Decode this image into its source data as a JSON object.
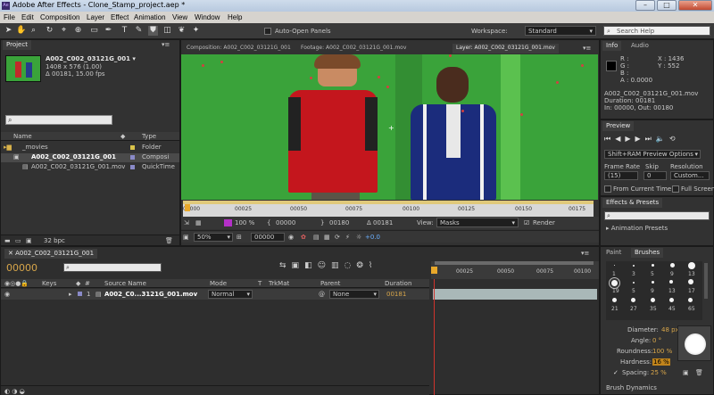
{
  "app": {
    "title": "Adobe After Effects - Clone_Stamp_project.aep *",
    "logo": "Ae"
  },
  "menu": [
    "File",
    "Edit",
    "Composition",
    "Layer",
    "Effect",
    "Animation",
    "View",
    "Window",
    "Help"
  ],
  "toolbar": {
    "auto_open_panels": "Auto-Open Panels",
    "workspace_label": "Workspace:",
    "workspace_value": "Standard",
    "search_help": "Search Help"
  },
  "project": {
    "tab": "Project",
    "item_name": "A002_C002_03121G_001 ▾",
    "item_size": "1408 x 576 (1.00)",
    "item_duration": "Δ 00181, 15.00 fps",
    "col_name": "Name",
    "col_type": "Type",
    "rows": [
      {
        "name": "_movies",
        "type": "Folder"
      },
      {
        "name": "A002_C002_03121G_001",
        "type": "Composi"
      },
      {
        "name": "A002_C002_03121G_001.mov",
        "type": "QuickTime"
      }
    ],
    "bpc": "32 bpc"
  },
  "viewer": {
    "tab_comp": "Composition: A002_C002_03121G_001",
    "tab_footage": "Footage: A002_C002_03121G_001.mov",
    "tab_layer": "Layer: A002_C002_03121G_001.mov",
    "ruler_ticks": [
      "00000",
      "00025",
      "00050",
      "00075",
      "00100",
      "00125",
      "00150",
      "00175"
    ],
    "time_current": "00000",
    "time_end": "00180",
    "time_duration": "Δ 00181",
    "view_label": "View:",
    "view_value": "Masks",
    "render_label": "Render",
    "zoom": "50%",
    "timecode": "00000",
    "exposure": "+0.0",
    "percent": "100 %"
  },
  "info": {
    "tab_info": "Info",
    "tab_audio": "Audio",
    "r": "R :",
    "g": "G :",
    "b": "B :",
    "a": "A : 0.0000",
    "x": "X : 1436",
    "y": "Y : 552",
    "file": "A002_C002_03121G_001.mov",
    "duration": "Duration: 00181",
    "inout": "In: 00000, Out: 00180"
  },
  "preview": {
    "tab": "Preview",
    "mode": "Shift+RAM Preview Options",
    "frame_rate_label": "Frame Rate",
    "frame_rate_value": "(15)",
    "skip_label": "Skip",
    "skip_value": "0",
    "resolution_label": "Resolution",
    "resolution_value": "Custom...",
    "from_current": "From Current Time",
    "full_screen": "Full Screen"
  },
  "effects": {
    "tab": "Effects & Presets",
    "animation_presets": "▸ Animation Presets"
  },
  "brushes": {
    "tab_paint": "Paint",
    "tab_brushes": "Brushes",
    "sizes": [
      "1",
      "3",
      "5",
      "9",
      "13",
      "19",
      "5",
      "9",
      "13",
      "17",
      "21",
      "27",
      "35",
      "45",
      "65"
    ],
    "diameter_label": "Diameter:",
    "diameter_value": "48 px",
    "angle_label": "Angle:",
    "angle_value": "0 °",
    "roundness_label": "Roundness:",
    "roundness_value": "100 %",
    "hardness_label": "Hardness:",
    "hardness_value": "16 %",
    "spacing_label": "Spacing:",
    "spacing_value": "25 %",
    "dynamics": "Brush Dynamics"
  },
  "timeline": {
    "tab": "A002_C002_03121G_001",
    "timecode": "00000",
    "col_keys": "Keys",
    "col_source": "Source Name",
    "col_mode": "Mode",
    "col_t": "T",
    "col_trkmat": "TrkMat",
    "col_parent": "Parent",
    "col_duration": "Duration",
    "layer_num": "1",
    "layer_name": "A002_C0...3121G_001.mov",
    "layer_mode": "Normal",
    "layer_parent": "None",
    "layer_duration": "00181",
    "ruler_ticks": [
      "00025",
      "00050",
      "00075",
      "00100"
    ]
  },
  "colors": {
    "accent_orange": "#d7a54a",
    "green_screen": "#3aa33a",
    "panel_bg": "#323232"
  }
}
